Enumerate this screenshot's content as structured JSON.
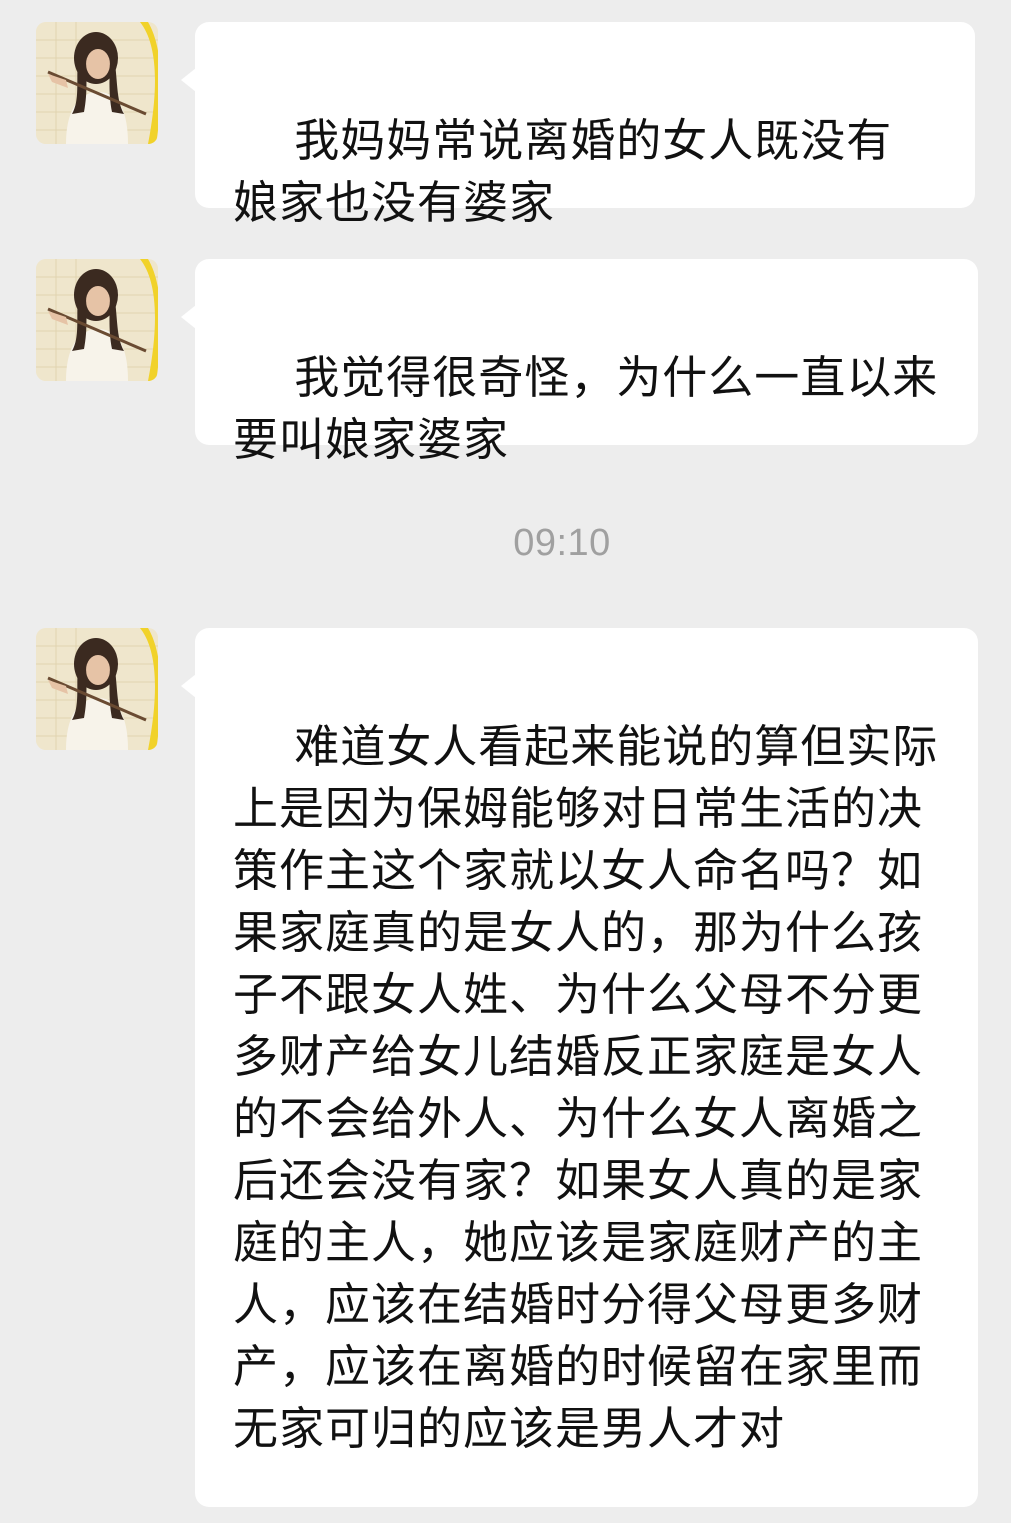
{
  "chat": {
    "messages": [
      {
        "text": "我妈妈常说离婚的女人既没有娘家也没有婆家"
      },
      {
        "text": "我觉得很奇怪，为什么一直以来要叫娘家婆家"
      },
      {
        "text": "难道女人看起来能说的算但实际上是因为保姆能够对日常生活的决策作主这个家就以女人命名吗？如果家庭真的是女人的，那为什么孩子不跟女人姓、为什么父母不分更多财产给女儿结婚反正家庭是女人的不会给外人、为什么女人离婚之后还会没有家？如果女人真的是家庭的主人，她应该是家庭财产的主人，应该在结婚时分得父母更多财产，应该在离婚的时候留在家里而无家可归的应该是男人才对"
      }
    ],
    "timestamp": "09:10"
  }
}
